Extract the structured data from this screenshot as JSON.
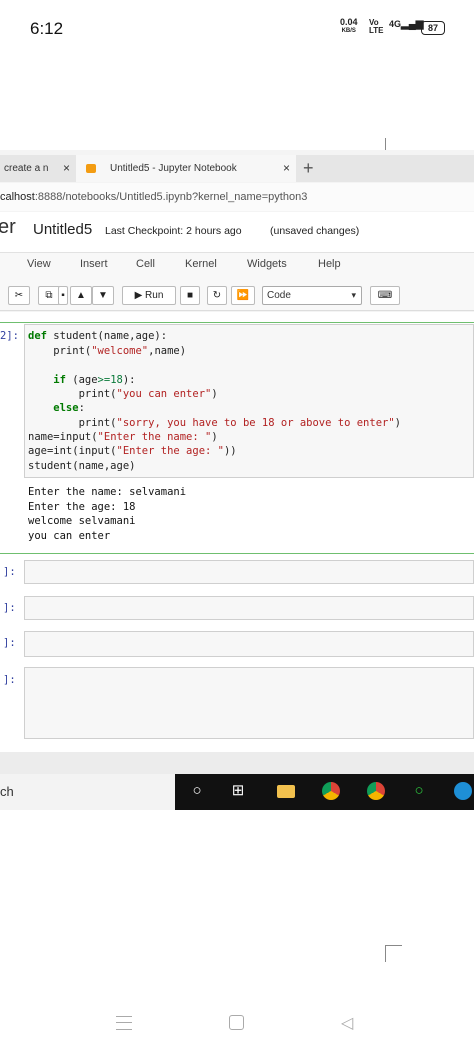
{
  "status_bar": {
    "time": "6:12",
    "net_speed_value": "0.04",
    "net_speed_unit": "KB/S",
    "volte": "Vo LTE",
    "signal": "4G",
    "battery": "87"
  },
  "browser": {
    "tabs": [
      {
        "label": "create a n",
        "close": "×"
      },
      {
        "label": "Untitled5 - Jupyter Notebook",
        "close": "×"
      }
    ],
    "new_tab": "+",
    "address_host": "calhost",
    "address_rest": ":8888/notebooks/Untitled5.ipynb?kernel_name=python3"
  },
  "jupyter": {
    "logo_text": "er",
    "notebook_title": "Untitled5",
    "checkpoint": "Last Checkpoint: 2 hours ago",
    "unsaved": "(unsaved changes)",
    "menu": [
      "View",
      "Insert",
      "Cell",
      "Kernel",
      "Widgets",
      "Help"
    ],
    "toolbar": {
      "run_label": "▶ Run",
      "cell_type": "Code"
    }
  },
  "cell": {
    "prompt": "2]:",
    "code": {
      "l1_kw": "def",
      "l1_rest": " student(name,age):",
      "l2_pre": "    print(",
      "l2_str": "\"welcome\"",
      "l2_post": ",name)",
      "l4_kw": "    if",
      "l4_pre": " (age",
      "l4_op": ">=18",
      "l4_post": "):",
      "l5_pre": "        print(",
      "l5_str": "\"you can enter\"",
      "l5_post": ")",
      "l6_kw": "    else",
      "l6_post": ":",
      "l7_pre": "        print(",
      "l7_str": "\"sorry, you have to be 18 or above to enter\"",
      "l7_post": ")",
      "l8_pre": "name=input(",
      "l8_str": "\"Enter the name: \"",
      "l8_post": ")",
      "l9_pre": "age=int(input(",
      "l9_str": "\"Enter the age: \"",
      "l9_post": "))",
      "l10": "student(name,age)"
    },
    "output": [
      "Enter the name: selvamani",
      "Enter the age: 18",
      "welcome selvamani",
      "you can enter"
    ]
  },
  "empty_cells": [
    {
      "prompt": "]:"
    },
    {
      "prompt": "]:"
    },
    {
      "prompt": "]:"
    },
    {
      "prompt": "]:"
    }
  ],
  "taskbar": {
    "search_fragment": "ch",
    "icons": [
      "cortana-icon",
      "task-view-icon",
      "file-explorer-icon",
      "chrome-icon",
      "chrome-alt-icon",
      "xbox-icon",
      "edge-icon"
    ]
  }
}
